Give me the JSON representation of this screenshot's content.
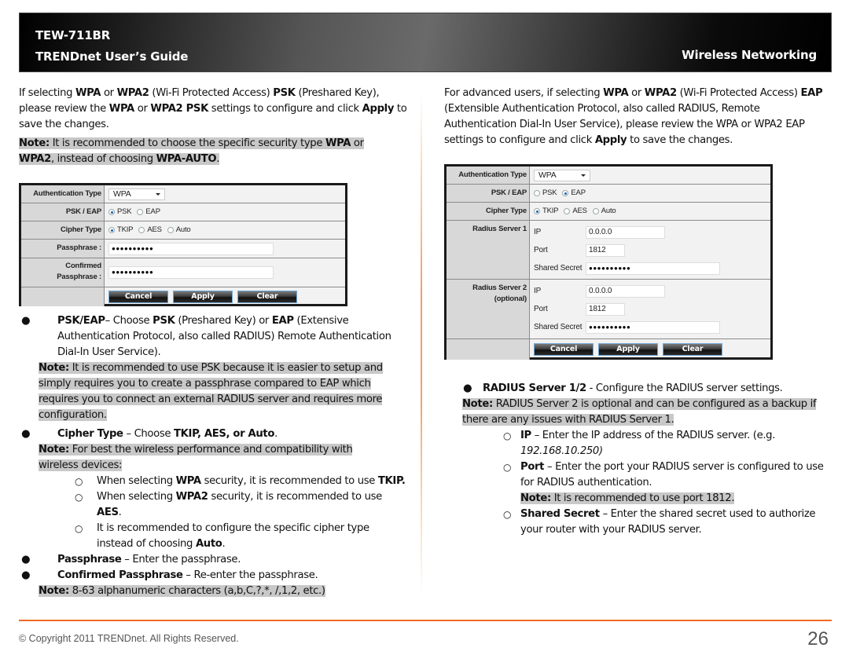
{
  "header": {
    "model": "TEW-711BR",
    "guide": "TRENDnet User’s Guide",
    "section": "Wireless Networking"
  },
  "left": {
    "intro": {
      "p1": "If selecting ",
      "b1": "WPA",
      "p2": " or ",
      "b2": "WPA2",
      "p3": " (Wi-Fi Protected Access) ",
      "b3": "PSK",
      "p4": " (Preshared Key), please review the ",
      "b4": "WPA",
      "p5": " or ",
      "b5": "WPA2 PSK",
      "p6": " settings to configure and click ",
      "b6": "Apply",
      "p7": " to save the changes."
    },
    "note1": {
      "label": "Note:",
      "t1": " It is recommended to choose the specific security type ",
      "b1": "WPA",
      "t2": " or ",
      "b2": "WPA2",
      "t3": ", instead of choosing ",
      "b3": "WPA-AUTO",
      "t4": "."
    },
    "form": {
      "auth_label": "Authentication Type",
      "auth_value": "WPA",
      "pskeap_label": "PSK / EAP",
      "psk": "PSK",
      "eap": "EAP",
      "cipher_label": "Cipher Type",
      "tkip": "TKIP",
      "aes": "AES",
      "auto": "Auto",
      "pass_label": "Passphrase :",
      "pass_value": "●●●●●●●●●●",
      "confirm_label1": "Confirmed",
      "confirm_label2": "Passphrase :",
      "confirm_value": "●●●●●●●●●●",
      "cancel": "Cancel",
      "apply": "Apply",
      "clear": "Clear"
    },
    "bullet_pskeap": {
      "b1": "PSK/EAP",
      "t1": "– Choose ",
      "b2": "PSK",
      "t2": " (Preshared Key) or ",
      "b3": "EAP",
      "t3": " (Extensive Authentication Protocol, also called RADIUS) Remote Authentication Dial-In User Service)."
    },
    "note2": {
      "label": "Note:",
      "text": " It is recommended to use PSK because it is easier to setup and simply requires you to create a passphrase compared to EAP which requires you to connect an external RADIUS server and requires more configuration."
    },
    "bullet_cipher": {
      "b1": "Cipher Type",
      "t1": " – Choose ",
      "b2": "TKIP, AES, or Auto",
      "t2": "."
    },
    "note3": {
      "label": "Note:",
      "text": " For best the wireless performance and compatibility with wireless devices:"
    },
    "sub1": {
      "t1": "When selecting ",
      "b1": "WPA",
      "t2": " security, it is recommended to use ",
      "b2": "TKIP."
    },
    "sub2": {
      "t1": "When selecting ",
      "b1": "WPA2",
      "t2": " security, it is recommended to use ",
      "b2": "AES",
      "t3": "."
    },
    "sub3": {
      "t1": "It is recommended to configure the specific cipher type instead of choosing ",
      "b1": "Auto",
      "t2": "."
    },
    "bullet_pass": {
      "b1": "Passphrase",
      "t1": " – Enter the passphrase."
    },
    "bullet_confirm": {
      "b1": "Confirmed Passphrase",
      "t1": " – Re-enter the passphrase."
    },
    "note4": {
      "label": "Note:",
      "text": " 8-63 alphanumeric characters (a,b,C,?,*, /,1,2, etc.)"
    }
  },
  "right": {
    "intro": {
      "p1": "For advanced users, if selecting ",
      "b1": "WPA",
      "p2": " or ",
      "b2": "WPA2",
      "p3": " (Wi-Fi Protected Access) ",
      "b3": "EAP",
      "p4": " (Extensible Authentication Protocol, also called RADIUS, Remote Authentication Dial-In User Service), please review the WPA or WPA2 EAP settings to configure and click ",
      "b4": "Apply",
      "p5": " to save the changes."
    },
    "form": {
      "auth_label": "Authentication Type",
      "auth_value": "WPA",
      "pskeap_label": "PSK / EAP",
      "psk": "PSK",
      "eap": "EAP",
      "cipher_label": "Cipher Type",
      "tkip": "TKIP",
      "aes": "AES",
      "auto": "Auto",
      "rs1_label": "Radius Server 1",
      "rs2_label1": "Radius Server 2",
      "rs2_label2": "(optional)",
      "ip_label": "IP",
      "port_label": "Port",
      "secret_label": "Shared Secret",
      "rs1_ip": "0.0.0.0",
      "rs1_port": "1812",
      "rs1_secret": "●●●●●●●●●●",
      "rs2_ip": "0.0.0.0",
      "rs2_port": "1812",
      "rs2_secret": "●●●●●●●●●●",
      "cancel": "Cancel",
      "apply": "Apply",
      "clear": "Clear"
    },
    "bullet_radius": {
      "b1": "RADIUS Server 1/2",
      "t1": " - Configure the RADIUS server settings."
    },
    "note1": {
      "label": "Note:",
      "text": " RADIUS Server 2 is optional and can be configured as a backup if there are any issues with RADIUS Server 1."
    },
    "sub_ip": {
      "b1": "IP",
      "t1": " – Enter the IP address of the RADIUS server. (e.g. ",
      "i1": "192.168.10.250)"
    },
    "sub_port": {
      "b1": "Port",
      "t1": " – Enter the port your RADIUS server is configured to use for RADIUS authentication."
    },
    "note_port": {
      "label": "Note:",
      "text": " It is recommended to use port 1812."
    },
    "sub_secret": {
      "b1": "Shared Secret",
      "t1": " – Enter the shared secret used to authorize your router with your RADIUS server."
    }
  },
  "footer": {
    "copyright": "© Copyright 2011 TRENDnet. All Rights Reserved.",
    "page": "26"
  }
}
